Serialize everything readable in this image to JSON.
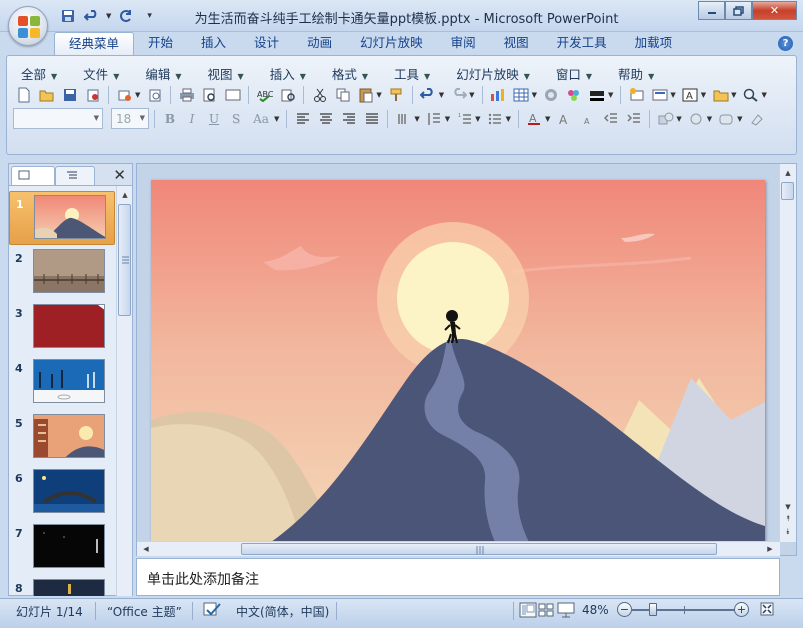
{
  "window": {
    "title": "为生活而奋斗纯手工绘制卡通矢量ppt模板.pptx - Microsoft PowerPoint",
    "controls": [
      "minimize-icon",
      "restore-icon",
      "close-icon"
    ]
  },
  "quick_access": [
    "save-icon",
    "undo-icon",
    "redo-icon",
    "customize-icon"
  ],
  "ribbon": {
    "tabs": [
      "经典菜单",
      "开始",
      "插入",
      "设计",
      "动画",
      "幻灯片放映",
      "审阅",
      "视图",
      "开发工具",
      "加载项"
    ],
    "active_tab": "经典菜单",
    "menus": [
      "全部",
      "文件",
      "编辑",
      "视图",
      "插入",
      "格式",
      "工具",
      "幻灯片放映",
      "窗口",
      "帮助"
    ],
    "font_name": "",
    "font_size": "18",
    "format_buttons": [
      "B",
      "I",
      "U",
      "S",
      "Aa"
    ]
  },
  "slides_pane": {
    "tabs": [
      "slides-tab",
      "outline-tab"
    ],
    "thumbnails": [
      {
        "num": "1",
        "theme": "sunset-mountain",
        "selected": true
      },
      {
        "num": "2",
        "theme": "hazy-bridge"
      },
      {
        "num": "3",
        "theme": "red-slide"
      },
      {
        "num": "4",
        "theme": "blue-scene"
      },
      {
        "num": "5",
        "theme": "sunset-cliff"
      },
      {
        "num": "6",
        "theme": "night-bridge"
      },
      {
        "num": "7",
        "theme": "dark-street"
      },
      {
        "num": "8",
        "theme": "dark-lamp"
      }
    ]
  },
  "notes": {
    "placeholder": "单击此处添加备注"
  },
  "status": {
    "slide_info": "幻灯片 1/14",
    "theme": "“Office 主题”",
    "language": "中文(简体，中国)",
    "zoom": "48%",
    "zoom_level": 0.48
  },
  "colors": {
    "accent": "#15428b",
    "ribbon": "#dde7f4",
    "selection": "#f7c16d"
  }
}
